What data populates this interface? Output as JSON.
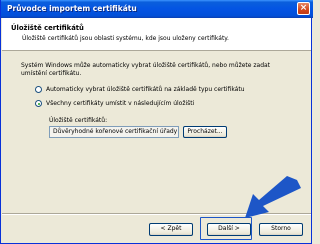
{
  "window": {
    "title": "Průvodce importem certifikátu",
    "close_label": "×"
  },
  "header": {
    "title": "Úložiště certifikátů",
    "subtitle": "Úložiště certifikátů jsou oblasti systému, kde jsou uloženy certifikáty."
  },
  "main": {
    "description": "Systém Windows může automaticky vybrat úložiště certifikátů, nebo můžete zadat umístění certifikátu.",
    "options": [
      {
        "label": "Automaticky vybrat úložiště certifikátů na základě typu certifikátu",
        "selected": false
      },
      {
        "label": "Všechny certifikáty umístit v následujícím úložišti",
        "selected": true
      }
    ],
    "store_label": "Úložiště certifikátů:",
    "store_value": "Důvěryhodné kořenové certifikační úřady",
    "browse_label": "Procházet..."
  },
  "footer": {
    "back_label": "< Zpět",
    "next_label": "Další >",
    "cancel_label": "Storno"
  },
  "colors": {
    "titlebar": "#0454e3",
    "arrow": "#1d56c7"
  }
}
